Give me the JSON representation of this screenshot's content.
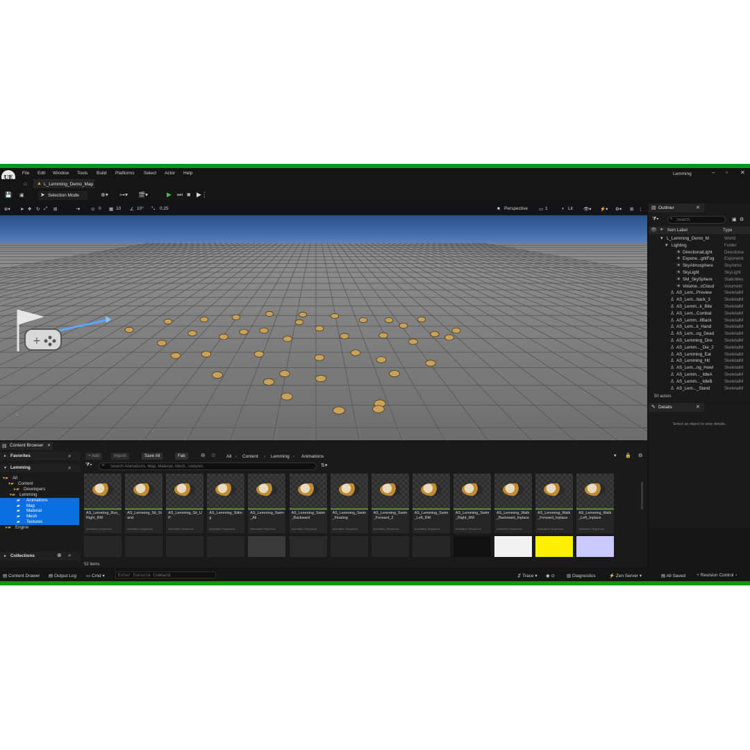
{
  "app": {
    "logo": "UE",
    "project_name": "Lemming",
    "menu": [
      "File",
      "Edit",
      "Window",
      "Tools",
      "Build",
      "Platforms",
      "Select",
      "Actor",
      "Help"
    ],
    "map_tab": "L_Lemming_Demo_Map",
    "window_controls": [
      "–",
      "▫",
      "✕"
    ]
  },
  "toolbar": {
    "selection_mode": "Selection Mode"
  },
  "viewport": {
    "controls": {
      "rotation_snap": "0",
      "grid_snap": "10",
      "angle_snap": "10°",
      "scale_snap": "0.25",
      "view_mode": "Perspective",
      "screen_count": "1",
      "lighting": "Lit"
    }
  },
  "outliner": {
    "title": "Outliner",
    "search_placeholder": "Search",
    "columns": {
      "label": "Item Label",
      "type": "Type"
    },
    "rows": [
      {
        "label": "L_Lemming_Demo_M",
        "type": "World"
      },
      {
        "label": "Lighting",
        "type": "Folder"
      },
      {
        "label": "DirectionalLight",
        "type": "Directiona"
      },
      {
        "label": "Expone...ghtFog",
        "type": "Exponenti"
      },
      {
        "label": "SkyAtmosphere",
        "type": "SkyAtmo"
      },
      {
        "label": "SkyLight",
        "type": "SkyLight"
      },
      {
        "label": "SM_SkySphere",
        "type": "StaticMes"
      },
      {
        "label": "Volume...cCloud",
        "type": "Volumetri"
      },
      {
        "label": "AS_Lem...Preview",
        "type": "SkeletalM"
      },
      {
        "label": "AS_Lem...ttack_3",
        "type": "SkeletalM"
      },
      {
        "label": "AS_Lemm...k_Bite",
        "type": "SkeletalM"
      },
      {
        "label": "AS_Lem...Combat",
        "type": "SkeletalM"
      },
      {
        "label": "AS_Lemm...llBack",
        "type": "SkeletalM"
      },
      {
        "label": "AS_Lem...k_Hand",
        "type": "SkeletalM"
      },
      {
        "label": "AS_Lem...ng_Dead",
        "type": "SkeletalM"
      },
      {
        "label": "AS_Lemming_Dire",
        "type": "SkeletalM"
      },
      {
        "label": "AS_Lemm..._Die_2",
        "type": "SkeletalM"
      },
      {
        "label": "AS_Lemming_Eat",
        "type": "SkeletalM"
      },
      {
        "label": "AS_Lemming_Hit",
        "type": "SkeletalM"
      },
      {
        "label": "AS_Lem...ng_Howl",
        "type": "SkeletalM"
      },
      {
        "label": "AS_Lemm..._IdleA",
        "type": "SkeletalM"
      },
      {
        "label": "AS_Lemm..._IdleB",
        "type": "SkeletalM"
      },
      {
        "label": "AS_Lem..._Stand",
        "type": "SkeletalM"
      }
    ],
    "actor_count": "50 actors"
  },
  "details": {
    "title": "Details",
    "empty_text": "Select an object to view details."
  },
  "content_browser": {
    "title": "Content Browser",
    "favorites": "Favorites",
    "project": "Lemming",
    "collections": "Collections",
    "tree": [
      "All",
      "Content",
      "Developers",
      "Lemming",
      "Animations",
      "Map",
      "Material",
      "Mesh",
      "Textures",
      "Engine"
    ],
    "buttons": {
      "add": "+ Add",
      "import": "Import",
      "save_all": "Save All",
      "fab": "Fab"
    },
    "breadcrumbs": [
      "All",
      "Content",
      "Lemming",
      "Animations"
    ],
    "search_placeholder": "Search Animations, Map, Material, Mesh, Textures",
    "assets": [
      {
        "name": "AS_Lemming_Run_Right_RM",
        "kind": "Animation Sequence"
      },
      {
        "name": "AS_Lemming_Sit_Stand",
        "kind": "Animation Sequence"
      },
      {
        "name": "AS_Lemming_Sit_UP",
        "kind": "Animation Sequence"
      },
      {
        "name": "AS_Lemming_Sitting",
        "kind": "Animation Sequence"
      },
      {
        "name": "AS_Lemming_Swim_All",
        "kind": "Animation Sequence"
      },
      {
        "name": "AS_Lemming_Swim_Backward",
        "kind": "Animation Sequence"
      },
      {
        "name": "AS_Lemming_Swim_Floating",
        "kind": "Animation Sequence"
      },
      {
        "name": "AS_Lemming_Swim_Forward_2",
        "kind": "Animation Sequence"
      },
      {
        "name": "AS_Lemming_Swim_Left_RM",
        "kind": "Animation Sequence"
      },
      {
        "name": "AS_Lemming_Swim_Right_RM",
        "kind": "Animation Sequence"
      },
      {
        "name": "AS_Lemming_Walk_Backward_Inplace",
        "kind": "Animation Sequence"
      },
      {
        "name": "AS_Lemming_Walk_Forward_Inplace",
        "kind": "Animation Sequence"
      },
      {
        "name": "AS_Lemming_Walk_Left_Inplace",
        "kind": "Animation Sequence"
      }
    ],
    "item_count": "52 items"
  },
  "statusbar": {
    "content_drawer": "Content Drawer",
    "output_log": "Output Log",
    "cmd": "Cmd",
    "console_placeholder": "Enter Console Command",
    "trace": "Trace",
    "diagnostics": "Diagnostics",
    "zen_server": "Zen Server",
    "all_saved": "All Saved",
    "revision_control": "Revision Control"
  },
  "colors": {
    "frame_green": "#009a1a",
    "selection_blue": "#0a6fe0",
    "play_green": "#3ec43e"
  }
}
